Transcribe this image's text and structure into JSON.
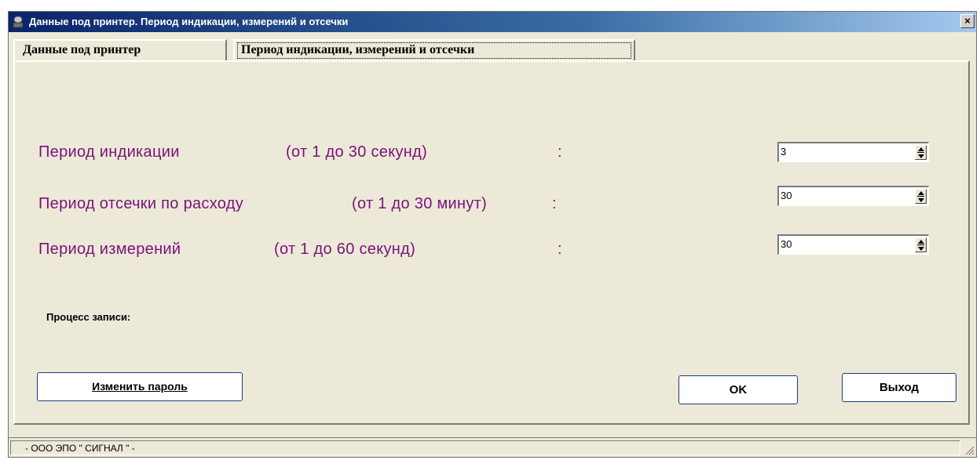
{
  "window": {
    "title": "Данные под принтер. Период индикации, измерений и отсечки",
    "close_glyph": "×"
  },
  "tabs": [
    {
      "label": "Данные под принтер",
      "active": false
    },
    {
      "label": "Период индикации, измерений и отсечки",
      "active": true
    }
  ],
  "params": [
    {
      "label": "Период индикации",
      "range": "(от 1 до 30 секунд)",
      "colon": ":",
      "value": "3"
    },
    {
      "label": "Период отсечки по расходу",
      "range": "(от 1 до 30 минут)",
      "colon": ":",
      "value": "30"
    },
    {
      "label": "Период измерений",
      "range": "(от 1 до 60 секунд)",
      "colon": ":",
      "value": "30"
    }
  ],
  "process": {
    "label": "Процесс записи:"
  },
  "buttons": {
    "change_password": "Изменить пароль",
    "ok": "OK",
    "exit": "Выход"
  },
  "status": {
    "text": "- ООО ЭПО \" СИГНАЛ \" -"
  },
  "colors": {
    "label_purple": "#7a127a",
    "title_bar": "#0a246a",
    "dialog_bg": "#ece9d8"
  }
}
